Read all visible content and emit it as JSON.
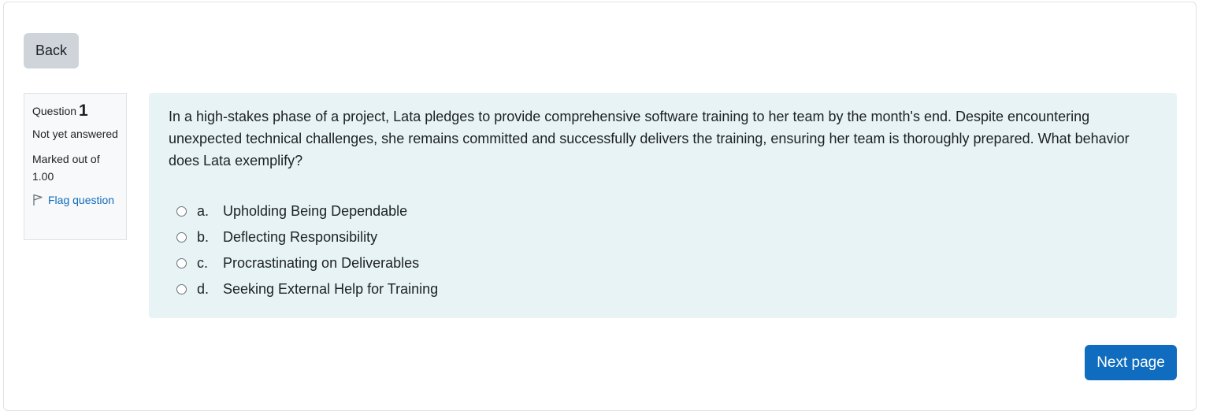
{
  "nav": {
    "back_label": "Back",
    "next_label": "Next page"
  },
  "question_info": {
    "heading_label": "Question",
    "number": "1",
    "state": "Not yet answered",
    "grade": "Marked out of 1.00",
    "flag_label": "Flag question",
    "flag_icon": "flag-outline-icon"
  },
  "question": {
    "text": "In a high-stakes phase of a project, Lata pledges to provide comprehensive software training to her team by the month's end. Despite encountering unexpected technical challenges, she remains committed and successfully delivers the training, ensuring her team is thoroughly prepared. What behavior does Lata exemplify?",
    "answers": [
      {
        "letter": "a.",
        "text": "Upholding Being Dependable"
      },
      {
        "letter": "b.",
        "text": "Deflecting Responsibility"
      },
      {
        "letter": "c.",
        "text": "Procrastinating on Deliverables"
      },
      {
        "letter": "d.",
        "text": "Seeking External Help for Training"
      }
    ]
  },
  "colors": {
    "primary": "#0f6cbf",
    "content_bg": "#e7f3f5",
    "info_bg": "#f8f9fa",
    "back_bg": "#ced4da"
  }
}
